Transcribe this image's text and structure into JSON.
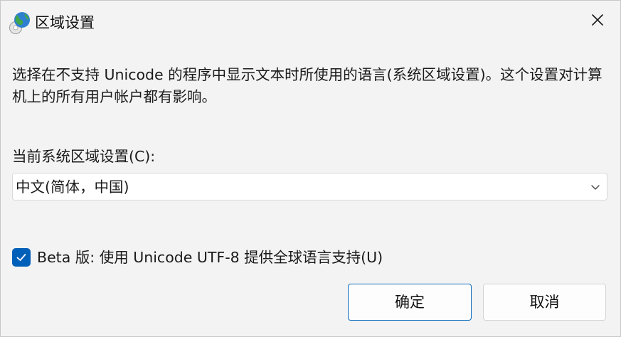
{
  "window": {
    "title": "区域设置",
    "app_icon": "globe-icon",
    "close_icon": "close-icon"
  },
  "description": "选择在不支持 Unicode 的程序中显示文本时所使用的语言(系统区域设置)。这个设置对计算机上的所有用户帐户都有影响。",
  "current_locale": {
    "label": "当前系统区域设置(C):",
    "selected_value": "中文(简体，中国)",
    "dropdown_icon": "chevron-down-icon"
  },
  "beta_option": {
    "label": "Beta 版: 使用 Unicode UTF-8 提供全球语言支持(U)",
    "checked": true
  },
  "buttons": {
    "ok_label": "确定",
    "cancel_label": "取消"
  },
  "colors": {
    "accent": "#005fb8",
    "background": "#f3f3f3",
    "field_background": "#ffffff"
  }
}
